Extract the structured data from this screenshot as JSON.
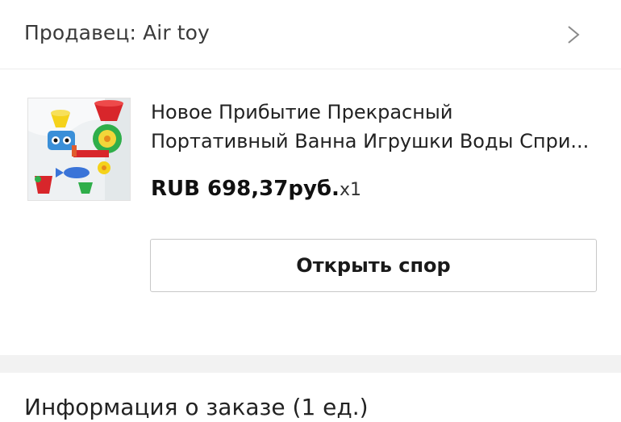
{
  "seller": {
    "label": "Продавец: Air toy",
    "chevron_icon": "chevron-right-icon"
  },
  "product": {
    "title_line1": "Новое Прибытие Прекрасный",
    "title_line2": "Портативный Ванна Игрушки Воды Спри...",
    "price": "RUB 698,37руб.",
    "quantity": "x1",
    "image_icon": "bath-toy-product-image"
  },
  "actions": {
    "open_dispute_label": "Открыть спор"
  },
  "order_info": {
    "heading": "Информация о заказе (1 ед.)"
  }
}
